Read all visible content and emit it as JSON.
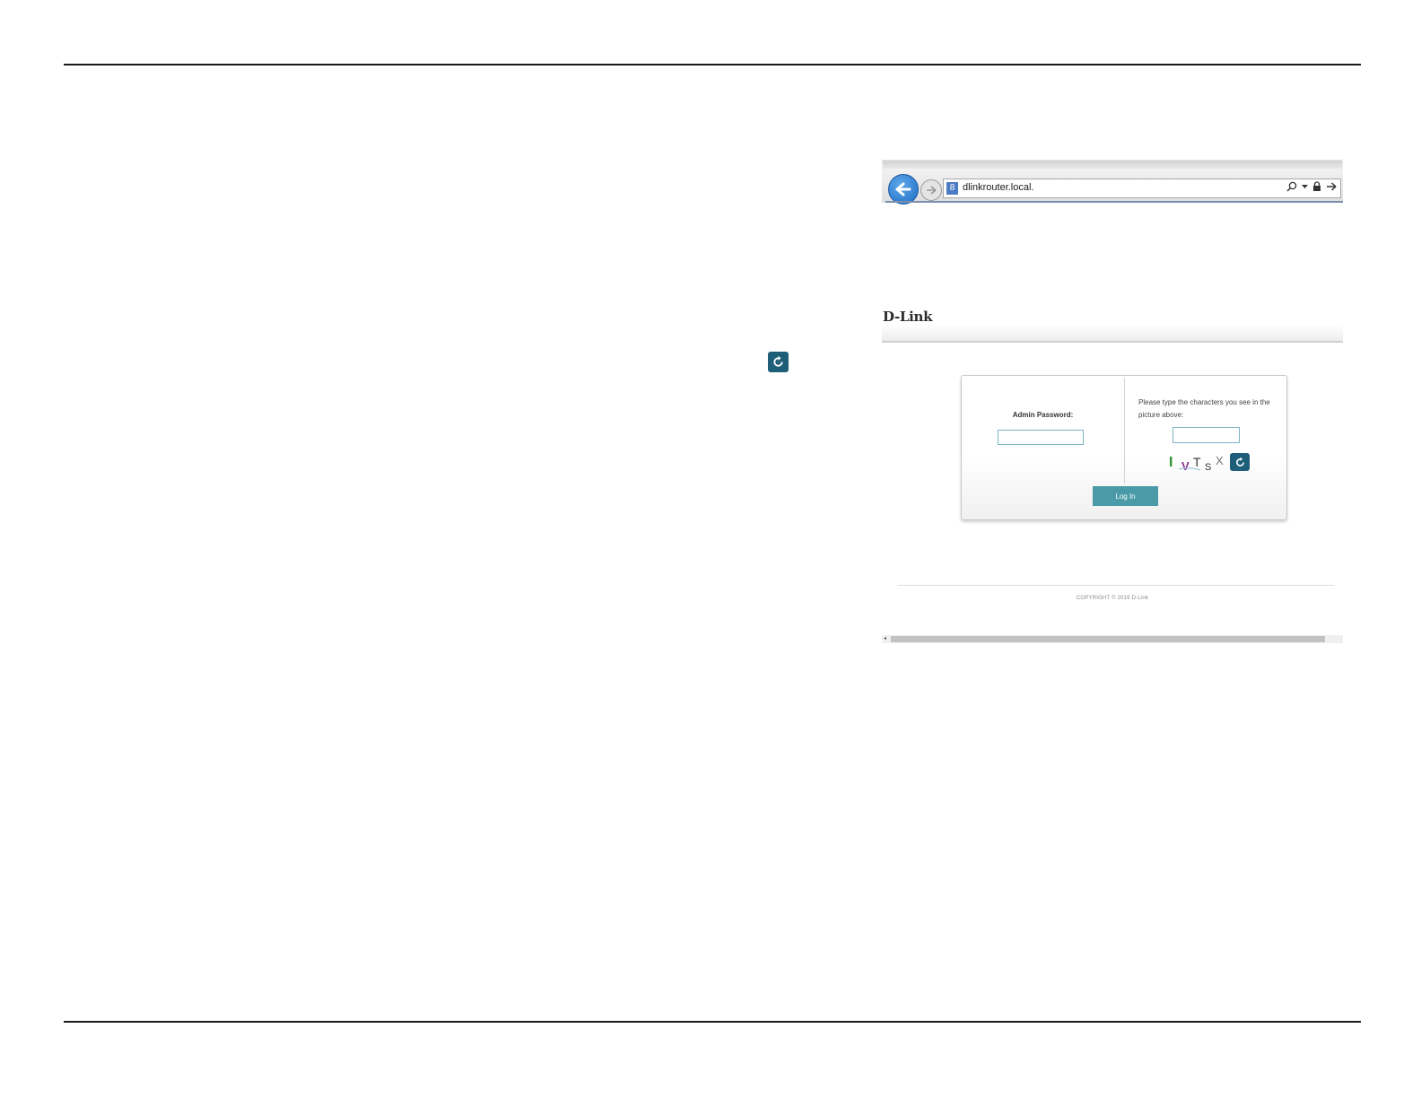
{
  "browser": {
    "url": "dlinkrouter.local.",
    "favicon_letter": "8",
    "icons": [
      "back-arrow-icon",
      "forward-arrow-icon",
      "search-icon",
      "dropdown-icon",
      "lock-icon",
      "go-arrow-icon"
    ]
  },
  "dlink": {
    "logo": "D-Link",
    "login": {
      "password_label": "Admin Password:",
      "captcha_prompt": "Please type the characters you see in the picture above:",
      "captcha_chars": [
        "I",
        "V",
        "T",
        "S",
        "X"
      ],
      "captcha_colors": [
        "#2f8f2f",
        "#8a2f8f",
        "#333333",
        "#333333",
        "#777777"
      ],
      "login_button": "Log In"
    },
    "footer": {
      "copyright": "COPYRIGHT © 2019 D-Link"
    }
  },
  "colors": {
    "accent_button": "#4a9aa8",
    "refresh_icon_bg": "#1e5e78",
    "rule": "#1a1a1a"
  }
}
